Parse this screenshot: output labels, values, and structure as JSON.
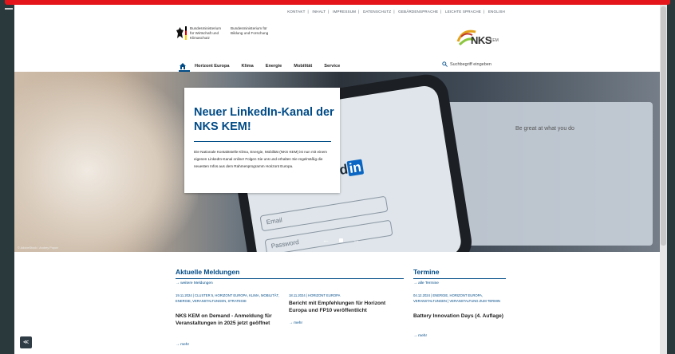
{
  "topnav": [
    "KONTAKT",
    "INHALT",
    "IMPRESSUM",
    "DATENSCHUTZ",
    "GEBÄRDENSPRACHE",
    "LEICHTE SPRACHE",
    "ENGLISH"
  ],
  "gov": {
    "ministry1": "Bundesministerium für Wirtschaft und Klimaschutz",
    "ministry2": "Bundesministerium für Bildung und Forschung"
  },
  "brand": {
    "name": "NKS",
    "sub": "KEM"
  },
  "mainnav": {
    "items": [
      "Horizont Europa",
      "Klima",
      "Energie",
      "Mobilität",
      "Service"
    ],
    "search_placeholder": "Suchbegriff eingeben"
  },
  "hero": {
    "title": "Neuer LinkedIn-Kanal der NKS KEM!",
    "text": "Die Nationale Kontaktstelle Klima, Energie, Mobilität (NKS KEM) ist nun mit einem eigenen LinkedIn-Kanal online! Folgen Sie uns und erhalten Sie regelmäßig die neuesten Infos aus dem Rahmenprogramm Horizont Europa.",
    "credit": "© AdobeStock / Andrey Popov",
    "linkedin_word": "ed",
    "linkedin_badge": "in",
    "email_placeholder": "Email",
    "password_placeholder": "Password",
    "screen_heading": "Be great at what you do",
    "prev": "←",
    "next": "→"
  },
  "news": {
    "title": "Aktuelle Meldungen",
    "more_link": "→ weitere Meldungen",
    "items": [
      {
        "meta": "19.11.2024 | CLUSTER 5, HORIZONT EUROPA, KLIMA, MOBILITÄT, ENERGIE, VERANSTALTUNGEN, STRATEGIE",
        "title": "NKS KEM on Demand - Anmeldung für Veranstaltungen in 2025 jetzt geöffnet",
        "more": "→ mehr"
      },
      {
        "meta": "18.11.2024 | HORIZONT EUROPA",
        "title": "Bericht mit Empfehlungen für Horizont Europa und FP10 veröffentlicht",
        "more": "→ mehr"
      }
    ]
  },
  "events": {
    "title": "Termine",
    "more_link": "→ alle Termine",
    "items": [
      {
        "meta": "04.12.2024 | ENERGIE, HORIZONT EUROPA, VERANSTALTUNGEN | VERANSTALTUNG ZUM TERMIN",
        "title": "Battery Innovation Days (4. Auflage)",
        "more": "→ mehr"
      }
    ]
  },
  "widget_label": "≪"
}
